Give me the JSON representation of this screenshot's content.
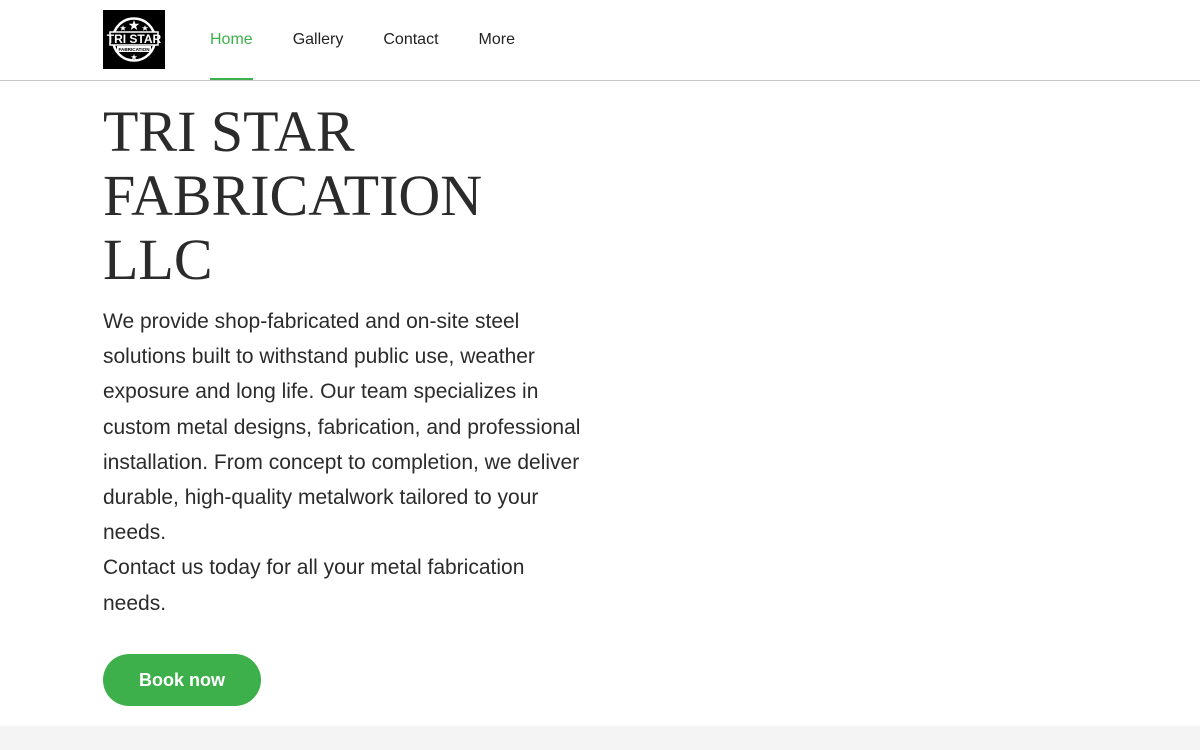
{
  "header": {
    "logo": {
      "icon": "tri-star-logo-icon",
      "text_main": "TRI STAR",
      "text_sub": "FABRICATION"
    },
    "nav": [
      {
        "label": "Home",
        "active": true
      },
      {
        "label": "Gallery",
        "active": false
      },
      {
        "label": "Contact",
        "active": false
      },
      {
        "label": "More",
        "active": false
      }
    ]
  },
  "hero": {
    "title_lines": [
      "TRI STAR",
      "FABRICATION",
      "LLC"
    ],
    "description": "We provide shop-fabricated and on-site steel solutions built to withstand public use, weather exposure and long life.   Our team specializes in custom metal designs, fabrication, and professional installation.  From concept to completion, we deliver durable, high-quality metalwork tailored to your needs.\nContact us today for all your metal fabrication needs.",
    "cta_label": "Book now"
  },
  "colors": {
    "accent": "#3db04b",
    "text": "#2b2b2b",
    "logo_bg": "#000000",
    "footer_band": "#f4f4f4"
  }
}
